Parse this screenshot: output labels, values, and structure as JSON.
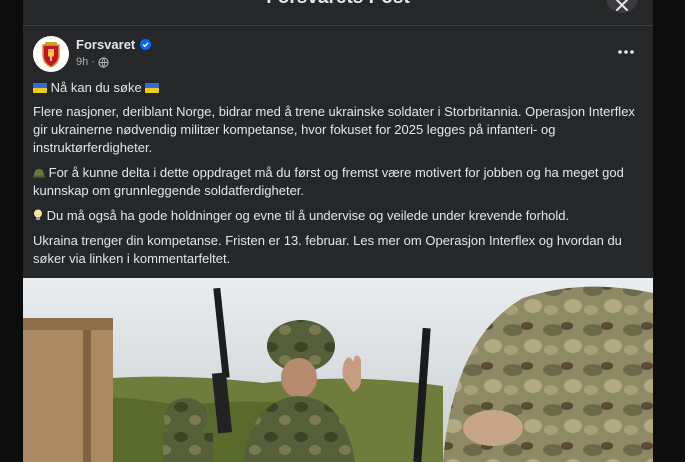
{
  "dialog": {
    "title": "Forsvarets Post",
    "close_icon": "close-icon"
  },
  "post": {
    "author": "Forsvaret",
    "verified_icon": "verified-badge-icon",
    "time": "9h",
    "audience_icon": "globe-icon",
    "more_icon": "more-options-icon",
    "headline": "Nå kan du søke",
    "paragraphs": [
      "Flere nasjoner, deriblant Norge, bidrar med å trene ukrainske soldater i Storbritannia. Operasjon Interflex gir ukrainerne nødvendig militær kompetanse, hvor fokuset for 2025 legges på infanteri- og instruktørferdigheter.",
      "For å kunne delta i dette oppdraget må du først og fremst være motivert for jobben og ha meget god kunnskap om grunnleggende soldatferdigheter.",
      "Du må også ha gode holdninger og evne til å undervise og veilede under krevende forhold.",
      "Ukraina trenger din kompetanse. Fristen er 13. februar. Les mer om Operasjon Interflex og hvordan du søker via linken i kommentarfeltet."
    ],
    "icons": {
      "flag": "ukraine-flag-icon",
      "p2": "army-helmet-icon",
      "p3": "lightbulb-icon"
    }
  }
}
